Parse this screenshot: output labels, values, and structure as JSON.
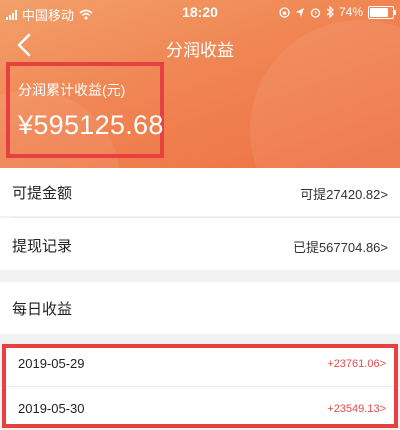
{
  "status_bar": {
    "carrier": "中国移动",
    "time": "18:20",
    "battery": "74%",
    "battery_level": 0.74,
    "icons": [
      "signal-icon",
      "wifi-icon",
      "lock-rotation-icon",
      "location-icon",
      "alarm-icon",
      "bluetooth-icon",
      "battery-icon"
    ]
  },
  "nav": {
    "title": "分润收益",
    "back_icon": "chevron-left-icon"
  },
  "summary": {
    "label": "分润累计收益(元)",
    "amount": "¥595125.68"
  },
  "rows": {
    "withdrawable": {
      "label": "可提金额",
      "value": "可提27420.82>"
    },
    "withdraw_records": {
      "label": "提现记录",
      "value": "已提567704.86>"
    },
    "daily": {
      "label": "每日收益"
    }
  },
  "daily_records": [
    {
      "date": "2019-05-29",
      "amount": "+23761.06>"
    },
    {
      "date": "2019-05-30",
      "amount": "+23549.13>"
    }
  ],
  "colors": {
    "header_gradient_start": "#f2a06a",
    "header_gradient_end": "#ee7143",
    "highlight_border": "#e84040",
    "positive_amount": "#e84a4a"
  }
}
